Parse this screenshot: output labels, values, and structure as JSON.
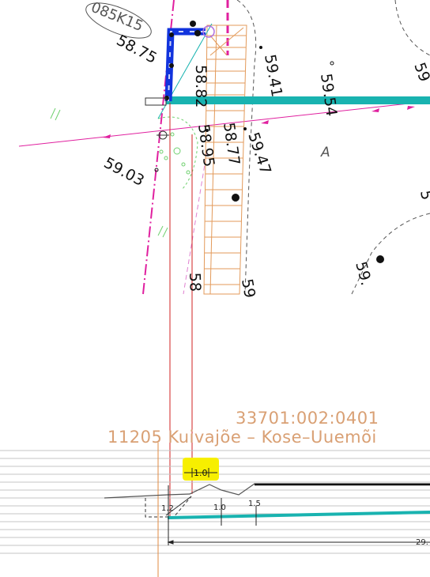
{
  "plan": {
    "label_085k15": "085K15",
    "elevations": {
      "e5875": "58.75",
      "e5882": "58.82",
      "e5941": "59.41",
      "e5954": "59.54",
      "e5877": "58.77",
      "e5895": "58.95",
      "e5947": "59.47",
      "e5903": "59.03",
      "e58b": "58",
      "e59c": "59.",
      "e59d": "5",
      "e59e": "59",
      "e5c": "59",
      "e5b": "5"
    },
    "area_letter": "A",
    "marks": {
      "slash_left": "//",
      "slash_bottom": "//"
    }
  },
  "profile": {
    "parcel_id": "33701:002:0401",
    "road_name": "11205 Kuivajõe – Kose–Uuemõi",
    "dims": {
      "highlight": "1.0",
      "d12": "1.2",
      "d10": "1.0",
      "d15": "1.5",
      "d29": "29."
    }
  },
  "colors": {
    "blue": "#1133dd",
    "cyan": "#19b3b0",
    "magenta": "#e0209f",
    "orange": "#e08a40",
    "red": "#d02020",
    "highlight": "#f7ef00",
    "grid": "#bdbdbd"
  }
}
